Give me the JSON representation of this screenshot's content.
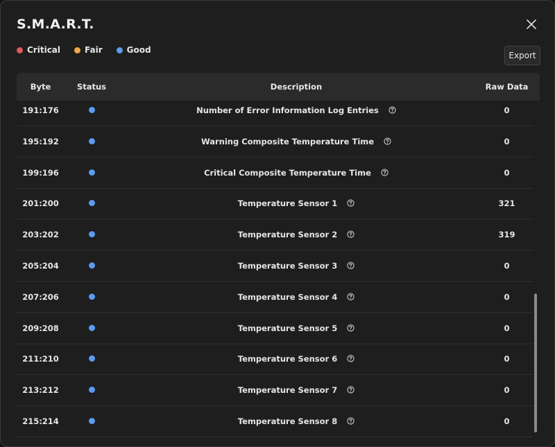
{
  "dialog": {
    "title": "S.M.A.R.T.",
    "close_icon": "close-icon",
    "export_label": "Export"
  },
  "legend": [
    {
      "label": "Critical",
      "color": "#e05a5a"
    },
    {
      "label": "Fair",
      "color": "#f0a64a"
    },
    {
      "label": "Good",
      "color": "#5b9cf0"
    }
  ],
  "table": {
    "headers": {
      "byte": "Byte",
      "status": "Status",
      "description": "Description",
      "raw_data": "Raw Data"
    },
    "rows": [
      {
        "byte": "191:176",
        "status": "good",
        "description": "Number of Error Information Log Entries",
        "raw": "0"
      },
      {
        "byte": "195:192",
        "status": "good",
        "description": "Warning Composite Temperature Time",
        "raw": "0"
      },
      {
        "byte": "199:196",
        "status": "good",
        "description": "Critical Composite Temperature Time",
        "raw": "0"
      },
      {
        "byte": "201:200",
        "status": "good",
        "description": "Temperature Sensor 1",
        "raw": "321"
      },
      {
        "byte": "203:202",
        "status": "good",
        "description": "Temperature Sensor 2",
        "raw": "319"
      },
      {
        "byte": "205:204",
        "status": "good",
        "description": "Temperature Sensor 3",
        "raw": "0"
      },
      {
        "byte": "207:206",
        "status": "good",
        "description": "Temperature Sensor 4",
        "raw": "0"
      },
      {
        "byte": "209:208",
        "status": "good",
        "description": "Temperature Sensor 5",
        "raw": "0"
      },
      {
        "byte": "211:210",
        "status": "good",
        "description": "Temperature Sensor 6",
        "raw": "0"
      },
      {
        "byte": "213:212",
        "status": "good",
        "description": "Temperature Sensor 7",
        "raw": "0"
      },
      {
        "byte": "215:214",
        "status": "good",
        "description": "Temperature Sensor 8",
        "raw": "0"
      }
    ]
  },
  "colors": {
    "good": "#5b9cf0",
    "fair": "#f0a64a",
    "critical": "#e05a5a"
  }
}
